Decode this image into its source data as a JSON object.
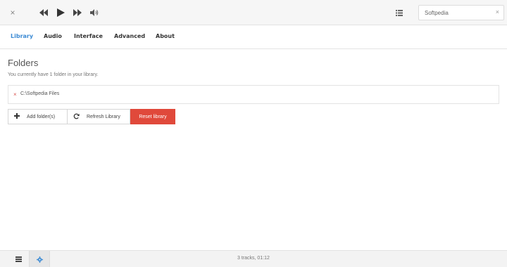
{
  "topbar": {
    "close_glyph": "×",
    "icons": {
      "close": "close-icon",
      "previous": "skip-back-icon",
      "play": "play-icon",
      "next": "skip-forward-icon",
      "volume": "volume-icon",
      "queue": "list-icon"
    },
    "search": {
      "value": "Softpedia",
      "clear_glyph": "×"
    }
  },
  "tabs": [
    {
      "label": "Library",
      "active": true
    },
    {
      "label": "Audio",
      "active": false
    },
    {
      "label": "Interface",
      "active": false
    },
    {
      "label": "Advanced",
      "active": false
    },
    {
      "label": "About",
      "active": false
    }
  ],
  "library": {
    "title": "Folders",
    "description": "You currently have 1 folder in your library.",
    "folders": [
      {
        "path": "C:\\Softpedia Files",
        "remove_glyph": "×"
      }
    ],
    "buttons": {
      "add": "Add folder(s)",
      "refresh": "Refresh Library",
      "reset": "Reset library"
    }
  },
  "statusbar": {
    "summary": "3 tracks, 01:12"
  },
  "colors": {
    "accent": "#3d8bd4",
    "danger": "#e0493b",
    "remove": "#d9534f",
    "topbar_bg": "#f6f6f6",
    "statusbar_bg": "#f3f3f3"
  }
}
